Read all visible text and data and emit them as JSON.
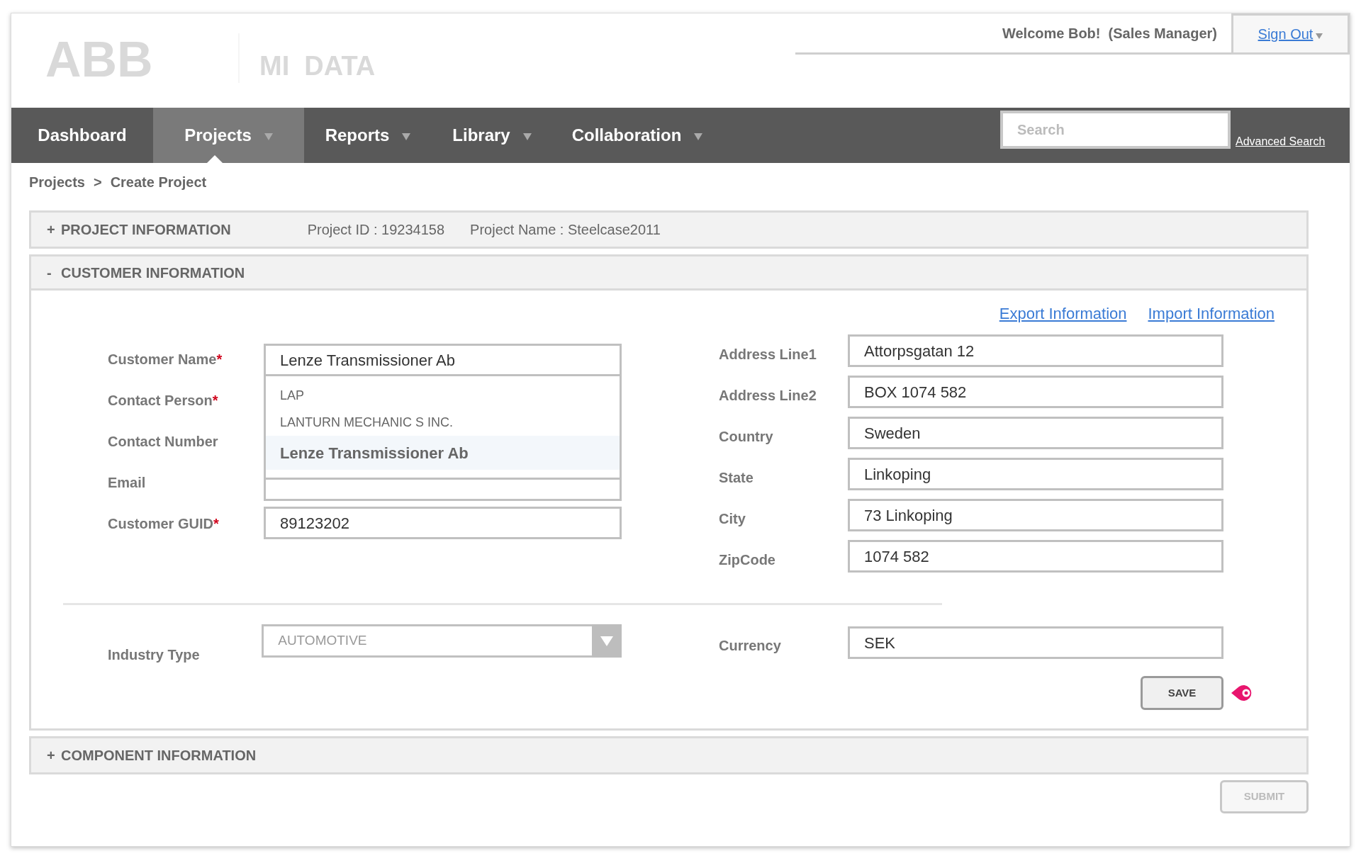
{
  "header": {
    "logo": "ABB",
    "app_name": "MI  DATA",
    "welcome": "Welcome Bob!  (Sales Manager)",
    "sign_out": "Sign Out"
  },
  "nav": {
    "tabs": [
      {
        "label": "Dashboard",
        "selected": false,
        "dropdown": false
      },
      {
        "label": "Projects",
        "selected": true,
        "dropdown": true
      },
      {
        "label": "Reports",
        "selected": false,
        "dropdown": true
      },
      {
        "label": "Library",
        "selected": false,
        "dropdown": true
      },
      {
        "label": "Collaboration",
        "selected": false,
        "dropdown": true
      }
    ],
    "search": {
      "placeholder": "Search"
    },
    "advanced_search": "Advanced Search"
  },
  "breadcrumb": {
    "items": [
      "Projects",
      "Create Project"
    ],
    "separator": ">"
  },
  "sections": [
    {
      "toggle": "+",
      "title": "PROJECT INFORMATION",
      "expanded": false,
      "details": [
        "Project ID : 19234158",
        "Project Name : Steelcase2011"
      ]
    },
    {
      "toggle": "-",
      "title": "CUSTOMER INFORMATION",
      "expanded": true
    },
    {
      "toggle": "+",
      "title": "COMPONENT INFORMATION",
      "expanded": false
    }
  ],
  "customer": {
    "links": [
      "Export Information",
      "Import Information"
    ],
    "required_mark": "*",
    "left_fields": [
      {
        "label": "Customer Name",
        "required": true,
        "value": "Lenze Transmissioner Ab"
      },
      {
        "label": "Contact Person",
        "required": true
      },
      {
        "label": "Contact Number",
        "required": false
      },
      {
        "label": "Email",
        "required": false
      },
      {
        "label": "Customer GUID",
        "required": true,
        "value": "89123202"
      }
    ],
    "suggestions": [
      {
        "label": "LAP",
        "selected": false
      },
      {
        "label": "LANTURN MECHANIC S INC.",
        "selected": false
      },
      {
        "label": "Lenze Transmissioner Ab",
        "selected": true
      }
    ],
    "right_fields": [
      {
        "label": "Address Line1",
        "value": "Attorpsgatan 12"
      },
      {
        "label": "Address Line2",
        "value": "BOX 1074 582"
      },
      {
        "label": "Country",
        "value": "Sweden"
      },
      {
        "label": "State",
        "value": "Linkoping"
      },
      {
        "label": "City",
        "value": "73 Linkoping"
      },
      {
        "label": "ZipCode",
        "value": "1074 582"
      }
    ],
    "industry": {
      "label": "Industry Type",
      "value": "AUTOMOTIVE"
    },
    "currency": {
      "label": "Currency",
      "value": "SEK"
    },
    "save": {
      "label": "SAVE",
      "disabled": false
    }
  },
  "submit": {
    "label": "SUBMIT",
    "disabled": true
  }
}
